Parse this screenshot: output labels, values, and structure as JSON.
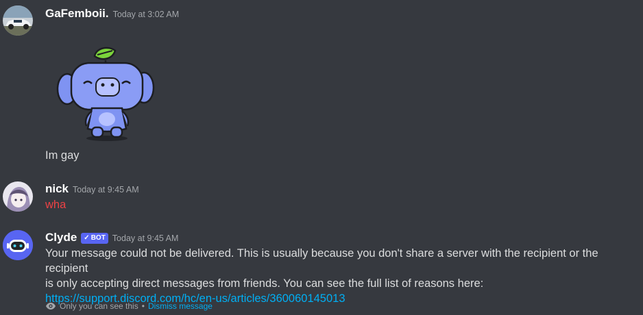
{
  "messages": [
    {
      "username": "GaFemboii.",
      "timestamp": "Today at 3:02 AM",
      "text": "Im gay"
    },
    {
      "username": "nick",
      "timestamp": "Today at 9:45 AM",
      "text": "wha",
      "text_color": "#ed4245"
    },
    {
      "username": "Clyde",
      "bot_tag": "BOT",
      "timestamp": "Today at 9:45 AM",
      "lines": [
        "Your message could not be delivered. This is usually because you don't share a server with the recipient or the recipient",
        "is only accepting direct messages from friends. You can see the full list of reasons here:"
      ],
      "link": "https://support.discord.com/hc/en-us/articles/360060145013",
      "ephemeral_note": "Only you can see this",
      "separator": "•",
      "dismiss_label": "Dismiss message"
    }
  ],
  "colors": {
    "background": "#36393f",
    "link": "#00aff4",
    "bot_tag": "#5865f2",
    "error_text": "#ed4245"
  },
  "icons": [
    "car-avatar-icon",
    "sticker-wumpus-icon",
    "anime-avatar-icon",
    "clyde-bot-avatar-icon",
    "eye-icon",
    "checkmark-icon"
  ]
}
